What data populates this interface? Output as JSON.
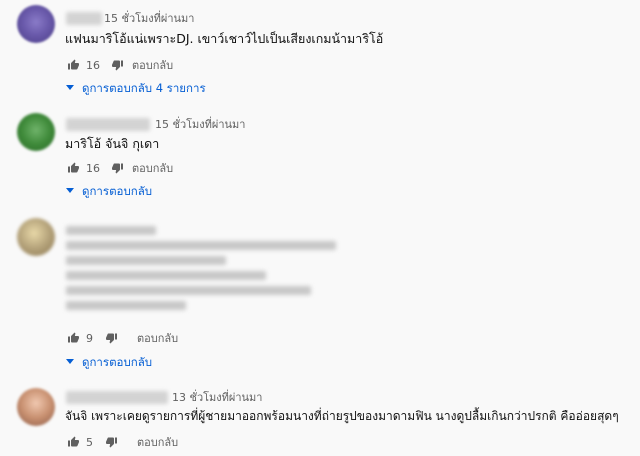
{
  "comments": [
    {
      "time": "15 ชั่วโมงที่ผ่านมา",
      "text": "แฟนมาริโอ้แน่เพราะDJ. เขาว์เชาว์ไปเป็นเสียงเกมน้ามาริโอ้",
      "likes": "16",
      "reply_label": "ตอบกลับ",
      "view_replies": "ดูการตอบกลับ 4 รายการ"
    },
    {
      "time": "15 ชั่วโมงที่ผ่านมา",
      "text": "มาริโอ้ จันจิ กุเดา",
      "likes": "16",
      "reply_label": "ตอบกลับ",
      "view_replies": "ดูการตอบกลับ"
    },
    {
      "likes": "9",
      "reply_label": "ตอบกลับ",
      "view_replies": "ดูการตอบกลับ"
    },
    {
      "time": "13 ชั่วโมงที่ผ่านมา",
      "text": "จันจิ เพราะเคยดูรายการที่ผู้ชายมาออกพร้อมนางที่ถ่ายรูปของมาดามฟิน นางดูปลื้มเกินกว่าปรกติ คืออ่อยสุดๆ",
      "likes": "5",
      "reply_label": "ตอบกลับ"
    }
  ],
  "colors": {
    "link": "#065fd4",
    "meta": "#606060",
    "text": "#0f0f0f"
  }
}
